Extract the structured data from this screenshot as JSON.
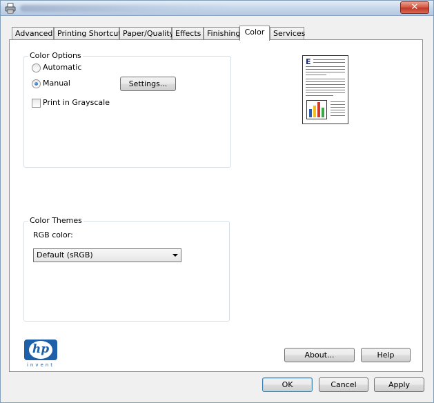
{
  "window": {
    "close_glyph": "✕",
    "tabs": [
      {
        "label": "Advanced"
      },
      {
        "label": "Printing Shortcuts"
      },
      {
        "label": "Paper/Quality"
      },
      {
        "label": "Effects"
      },
      {
        "label": "Finishing"
      },
      {
        "label": "Color"
      },
      {
        "label": "Services"
      }
    ],
    "active_tab": "Color"
  },
  "color_options": {
    "legend": "Color Options",
    "automatic_label": "Automatic",
    "manual_label": "Manual",
    "selected": "Manual",
    "settings_button": "Settings...",
    "grayscale_label": "Print in Grayscale",
    "grayscale_checked": false
  },
  "color_themes": {
    "legend": "Color Themes",
    "rgb_label": "RGB color:",
    "rgb_value": "Default (sRGB)"
  },
  "preview": {
    "heading_letter": "E",
    "bar_colors": [
      "#2a5db0",
      "#f0c020",
      "#d23a2a",
      "#3aa845"
    ]
  },
  "logo": {
    "brand": "hp",
    "tagline": "invent",
    "color": "#1d5fa8"
  },
  "buttons": {
    "about": "About...",
    "help": "Help",
    "ok": "OK",
    "cancel": "Cancel",
    "apply": "Apply"
  }
}
